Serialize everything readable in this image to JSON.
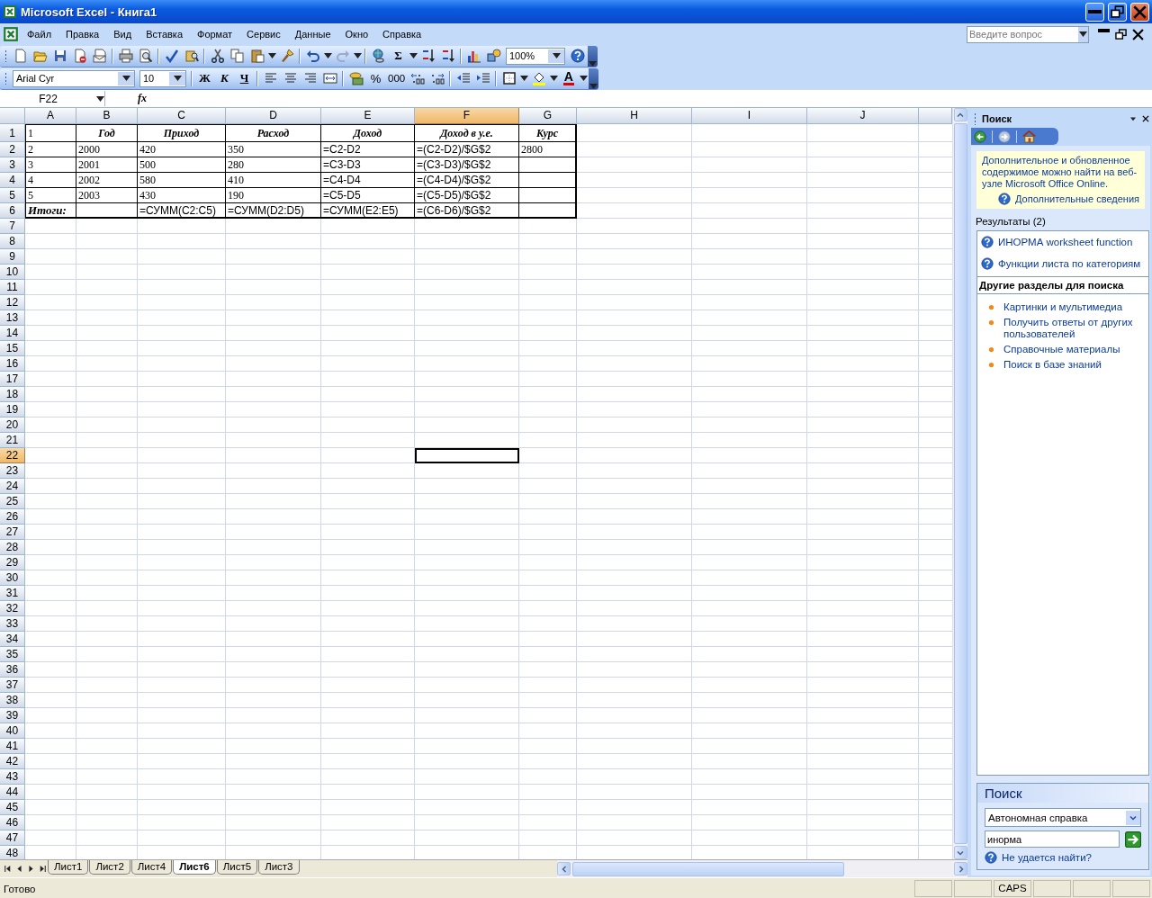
{
  "window": {
    "title": "Microsoft Excel - Книга1"
  },
  "menu": [
    "Файл",
    "Правка",
    "Вид",
    "Вставка",
    "Формат",
    "Сервис",
    "Данные",
    "Окно",
    "Справка"
  ],
  "ask_field": {
    "placeholder": "Введите вопрос"
  },
  "standard_toolbar": {
    "autosum": "Σ",
    "zoom": "100%"
  },
  "formatting_toolbar": {
    "font": "Arial Cyr",
    "size": "10",
    "bold": "Ж",
    "italic": "К",
    "underline": "Ч",
    "percent": "%",
    "thousands": "000",
    "font_color": "A"
  },
  "formula_bar": {
    "name_box": "F22",
    "fx": "fx"
  },
  "columns": [
    {
      "label": "A",
      "selected": false
    },
    {
      "label": "B",
      "selected": false
    },
    {
      "label": "C",
      "selected": false
    },
    {
      "label": "D",
      "selected": false
    },
    {
      "label": "E",
      "selected": false
    },
    {
      "label": "F",
      "selected": true
    },
    {
      "label": "G",
      "selected": false
    },
    {
      "label": "H",
      "selected": false
    },
    {
      "label": "I",
      "selected": false
    },
    {
      "label": "J",
      "selected": false
    }
  ],
  "rows": [
    {
      "label": "1",
      "selected": false,
      "cells": [
        {
          "text": "1",
          "kind": "value"
        },
        {
          "text": "Год",
          "kind": "heading"
        },
        {
          "text": "Приход",
          "kind": "heading"
        },
        {
          "text": "Расход",
          "kind": "heading"
        },
        {
          "text": "Доход",
          "kind": "heading"
        },
        {
          "text": "Доход в у.е.",
          "kind": "heading"
        },
        {
          "text": "Курс",
          "kind": "heading"
        }
      ]
    },
    {
      "label": "2",
      "selected": false,
      "cells": [
        {
          "text": "2",
          "kind": "value"
        },
        {
          "text": "2000",
          "kind": "value"
        },
        {
          "text": "420",
          "kind": "value"
        },
        {
          "text": "350",
          "kind": "value"
        },
        {
          "text": "=C2-D2",
          "kind": "formula"
        },
        {
          "text": "=(C2-D2)/$G$2",
          "kind": "formula"
        },
        {
          "text": "2800",
          "kind": "value"
        }
      ]
    },
    {
      "label": "3",
      "selected": false,
      "cells": [
        {
          "text": "3",
          "kind": "value"
        },
        {
          "text": "2001",
          "kind": "value"
        },
        {
          "text": "500",
          "kind": "value"
        },
        {
          "text": "280",
          "kind": "value"
        },
        {
          "text": "=C3-D3",
          "kind": "formula"
        },
        {
          "text": "=(C3-D3)/$G$2",
          "kind": "formula"
        },
        null
      ]
    },
    {
      "label": "4",
      "selected": false,
      "cells": [
        {
          "text": "4",
          "kind": "value"
        },
        {
          "text": "2002",
          "kind": "value"
        },
        {
          "text": "580",
          "kind": "value"
        },
        {
          "text": "410",
          "kind": "value"
        },
        {
          "text": "=C4-D4",
          "kind": "formula"
        },
        {
          "text": "=(C4-D4)/$G$2",
          "kind": "formula"
        },
        null
      ]
    },
    {
      "label": "5",
      "selected": false,
      "cells": [
        {
          "text": "5",
          "kind": "value"
        },
        {
          "text": "2003",
          "kind": "value"
        },
        {
          "text": "430",
          "kind": "value"
        },
        {
          "text": "190",
          "kind": "value"
        },
        {
          "text": "=C5-D5",
          "kind": "formula"
        },
        {
          "text": "=(C5-D5)/$G$2",
          "kind": "formula"
        },
        null
      ]
    },
    {
      "label": "6",
      "selected": false,
      "cells": [
        {
          "text": "Итоги:",
          "kind": "total_label"
        },
        null,
        {
          "text": "=СУММ(C2:C5)",
          "kind": "formula"
        },
        {
          "text": "=СУММ(D2:D5)",
          "kind": "formula"
        },
        {
          "text": "=СУММ(E2:E5)",
          "kind": "formula"
        },
        {
          "text": "=(C6-D6)/$G$2",
          "kind": "formula"
        },
        null
      ]
    },
    {
      "label": "7",
      "selected": false
    },
    {
      "label": "8",
      "selected": false
    },
    {
      "label": "9",
      "selected": false
    },
    {
      "label": "10",
      "selected": false
    },
    {
      "label": "11",
      "selected": false
    },
    {
      "label": "12",
      "selected": false
    },
    {
      "label": "13",
      "selected": false
    },
    {
      "label": "14",
      "selected": false
    },
    {
      "label": "15",
      "selected": false
    },
    {
      "label": "16",
      "selected": false
    },
    {
      "label": "17",
      "selected": false
    },
    {
      "label": "18",
      "selected": false
    },
    {
      "label": "19",
      "selected": false
    },
    {
      "label": "20",
      "selected": false
    },
    {
      "label": "21",
      "selected": false
    },
    {
      "label": "22",
      "selected": true
    },
    {
      "label": "23",
      "selected": false
    },
    {
      "label": "24",
      "selected": false
    },
    {
      "label": "25",
      "selected": false
    },
    {
      "label": "26",
      "selected": false
    },
    {
      "label": "27",
      "selected": false
    },
    {
      "label": "28",
      "selected": false
    },
    {
      "label": "29",
      "selected": false
    },
    {
      "label": "30",
      "selected": false
    },
    {
      "label": "31",
      "selected": false
    },
    {
      "label": "32",
      "selected": false
    },
    {
      "label": "33",
      "selected": false
    },
    {
      "label": "34",
      "selected": false
    },
    {
      "label": "35",
      "selected": false
    },
    {
      "label": "36",
      "selected": false
    },
    {
      "label": "37",
      "selected": false
    },
    {
      "label": "38",
      "selected": false
    },
    {
      "label": "39",
      "selected": false
    },
    {
      "label": "40",
      "selected": false
    },
    {
      "label": "41",
      "selected": false
    },
    {
      "label": "42",
      "selected": false
    },
    {
      "label": "43",
      "selected": false
    },
    {
      "label": "44",
      "selected": false
    },
    {
      "label": "45",
      "selected": false
    },
    {
      "label": "46",
      "selected": false
    },
    {
      "label": "47",
      "selected": false
    },
    {
      "label": "48",
      "selected": false
    }
  ],
  "sheet_tabs": [
    {
      "label": "Лист1",
      "selected": false
    },
    {
      "label": "Лист2",
      "selected": false
    },
    {
      "label": "Лист4",
      "selected": false
    },
    {
      "label": "Лист6",
      "selected": true
    },
    {
      "label": "Лист5",
      "selected": false
    },
    {
      "label": "Лист3",
      "selected": false
    }
  ],
  "task_pane": {
    "title": "Поиск",
    "notice": {
      "text": "Дополнительное и обновленное содержимое можно найти на веб-узле Microsoft Office Online.",
      "link": "Дополнительные сведения"
    },
    "results_title": "Результаты (2)",
    "results": [
      "ИНОРМА worksheet function",
      "Функции листа по категориям"
    ],
    "other_title": "Другие разделы для поиска",
    "other_links": [
      "Картинки и мультимедиа",
      "Получить ответы от других пользователей",
      "Справочные материалы",
      "Поиск в базе знаний"
    ],
    "search": {
      "title": "Поиск",
      "scope": "Автономная справка",
      "query": "инорма",
      "help_link": "Не удается найти?"
    }
  },
  "status_bar": {
    "text": "Готово",
    "indicators": [
      "CAPS"
    ]
  }
}
